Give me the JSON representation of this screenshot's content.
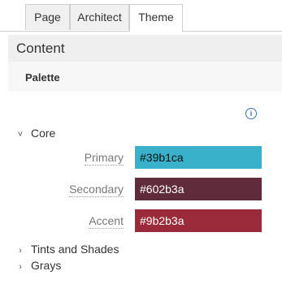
{
  "tabs": [
    {
      "label": "Page",
      "active": false
    },
    {
      "label": "Architect",
      "active": false
    },
    {
      "label": "Theme",
      "active": true
    }
  ],
  "section": {
    "title": "Content"
  },
  "subsection": {
    "title": "Palette"
  },
  "info_icon": {
    "glyph": "i",
    "icon": "info-icon"
  },
  "groups": {
    "core": {
      "label": "Core",
      "expanded": true,
      "chevron": "˅"
    },
    "tints": {
      "label": "Tints and Shades",
      "expanded": false,
      "chevron": "›"
    },
    "grays": {
      "label": "Grays",
      "expanded": false,
      "chevron": "›"
    }
  },
  "colors": [
    {
      "label": "Primary",
      "value": "#39b1ca"
    },
    {
      "label": "Secondary",
      "value": "#602b3a"
    },
    {
      "label": "Accent",
      "value": "#9b2b3a"
    }
  ]
}
